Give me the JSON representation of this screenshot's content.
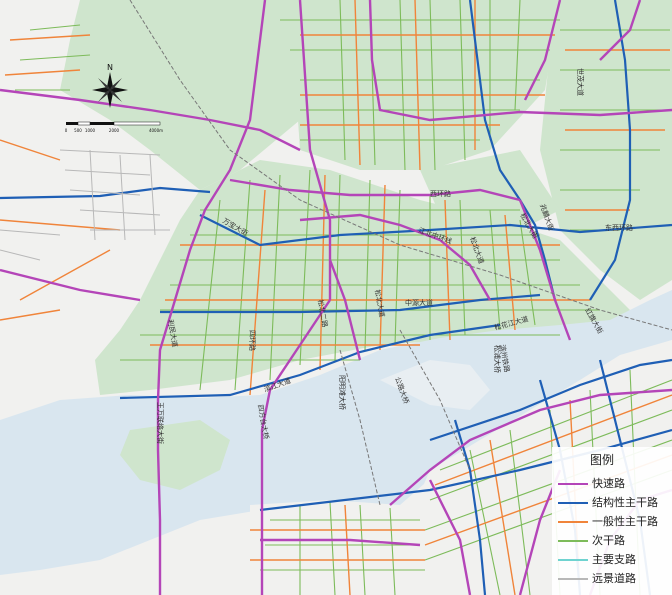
{
  "legend": {
    "title": "图例",
    "items": [
      {
        "label": "快速路",
        "color": "#b445b8"
      },
      {
        "label": "结构性主干路",
        "color": "#1f5fb5"
      },
      {
        "label": "一般性主干路",
        "color": "#f0843a"
      },
      {
        "label": "次干路",
        "color": "#7dbb5a"
      },
      {
        "label": "主要支路",
        "color": "#6fd3d0"
      },
      {
        "label": "远景道路",
        "color": "#b8b8b8"
      }
    ]
  },
  "compass": {
    "north_label": "N"
  },
  "scale": {
    "labels": [
      "0",
      "500",
      "1000",
      "2000",
      "4000m"
    ]
  },
  "colors": {
    "land": "#f1f1ef",
    "water": "#d9e6ef",
    "green": "#cfe5cd"
  },
  "road_labels": [
    "万宝大街",
    "西环路",
    "江北中环线",
    "松北大道",
    "东西环路",
    "世茂大道",
    "松北大街",
    "中源大道",
    "滨江大道",
    "松花江大道",
    "松浦大桥",
    "红旗大街",
    "王万联络大街",
    "四环路",
    "阳明滩大桥",
    "公路大桥",
    "滨州铁路",
    "四方台大桥",
    "利民大道",
    "松北二路",
    "松北大道",
    "兆麟大街"
  ]
}
